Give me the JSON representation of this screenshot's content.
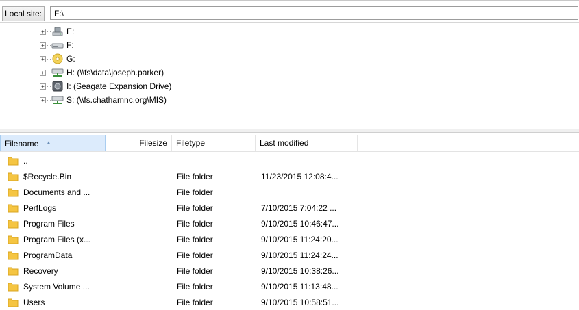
{
  "local_site": {
    "label": "Local site:",
    "path": "F:\\"
  },
  "tree": [
    {
      "label": "E:",
      "icon": "usb-drive-icon"
    },
    {
      "label": "F:",
      "icon": "hard-drive-icon"
    },
    {
      "label": "G:",
      "icon": "dvd-drive-icon"
    },
    {
      "label": "H: (\\\\fs\\data\\joseph.parker)",
      "icon": "network-drive-icon"
    },
    {
      "label": "I: (Seagate Expansion Drive)",
      "icon": "external-drive-icon"
    },
    {
      "label": "S: (\\\\fs.chathamnc.org\\MIS)",
      "icon": "network-drive-icon"
    }
  ],
  "columns": {
    "filename": "Filename",
    "filesize": "Filesize",
    "filetype": "Filetype",
    "last_modified": "Last modified"
  },
  "files": [
    {
      "name": "..",
      "type": "",
      "modified": ""
    },
    {
      "name": "$Recycle.Bin",
      "type": "File folder",
      "modified": "11/23/2015 12:08:4..."
    },
    {
      "name": "Documents and ...",
      "type": "File folder",
      "modified": ""
    },
    {
      "name": "PerfLogs",
      "type": "File folder",
      "modified": "7/10/2015 7:04:22 ..."
    },
    {
      "name": "Program Files",
      "type": "File folder",
      "modified": "9/10/2015 10:46:47..."
    },
    {
      "name": "Program Files (x...",
      "type": "File folder",
      "modified": "9/10/2015 11:24:20..."
    },
    {
      "name": "ProgramData",
      "type": "File folder",
      "modified": "9/10/2015 11:24:24..."
    },
    {
      "name": "Recovery",
      "type": "File folder",
      "modified": "9/10/2015 10:38:26..."
    },
    {
      "name": "System Volume ...",
      "type": "File folder",
      "modified": "9/10/2015 11:13:48..."
    },
    {
      "name": "Users",
      "type": "File folder",
      "modified": "9/10/2015 10:58:51..."
    }
  ],
  "colors": {
    "folder": "#f5c542",
    "sort_header": "#dcebfc",
    "border": "#d6d6d6"
  }
}
